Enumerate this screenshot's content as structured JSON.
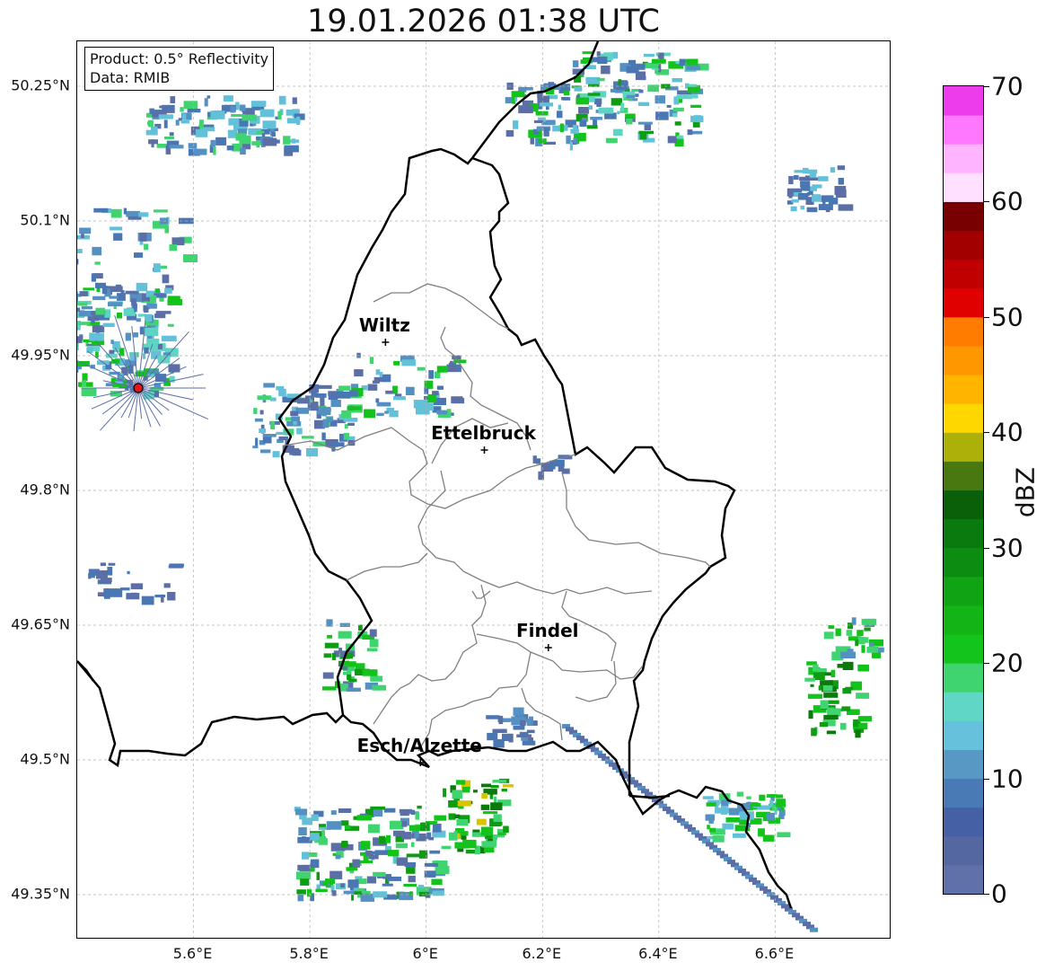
{
  "title": "19.01.2026 01:38 UTC",
  "info": {
    "product": "Product: 0.5° Reflectivity",
    "source": "Data: RMIB"
  },
  "map": {
    "lon_range": [
      5.4,
      6.8
    ],
    "lat_range": [
      49.3,
      50.3
    ],
    "lat_ticks": [
      {
        "value": 50.25,
        "label": "50.25°N"
      },
      {
        "value": 50.1,
        "label": "50.1°N"
      },
      {
        "value": 49.95,
        "label": "49.95°N"
      },
      {
        "value": 49.8,
        "label": "49.8°N"
      },
      {
        "value": 49.65,
        "label": "49.65°N"
      },
      {
        "value": 49.5,
        "label": "49.5°N"
      },
      {
        "value": 49.35,
        "label": "49.35°N"
      }
    ],
    "lon_ticks": [
      {
        "value": 5.6,
        "label": "5.6°E"
      },
      {
        "value": 5.8,
        "label": "5.8°E"
      },
      {
        "value": 6.0,
        "label": "6°E"
      },
      {
        "value": 6.2,
        "label": "6.2°E"
      },
      {
        "value": 6.4,
        "label": "6.4°E"
      },
      {
        "value": 6.6,
        "label": "6.6°E"
      }
    ],
    "radar_site": {
      "lon": 5.505,
      "lat": 49.914
    },
    "cities": [
      {
        "name": "Wiltz",
        "lon": 5.93,
        "lat": 49.965
      },
      {
        "name": "Ettelbruck",
        "lon": 6.1,
        "lat": 49.845
      },
      {
        "name": "Findel",
        "lon": 6.21,
        "lat": 49.625
      },
      {
        "name": "Esch/Alzette",
        "lon": 5.99,
        "lat": 49.497
      }
    ],
    "colors": {
      "country_border": "#000000",
      "canton_border": "#808080",
      "radar_site": "#e8141c",
      "grid": "#b0b0b0"
    }
  },
  "colorbar": {
    "label": "dBZ",
    "min": 0,
    "max": 70,
    "ticks": [
      {
        "value": 0,
        "label": "0"
      },
      {
        "value": 10,
        "label": "10"
      },
      {
        "value": 20,
        "label": "20"
      },
      {
        "value": 30,
        "label": "30"
      },
      {
        "value": 40,
        "label": "40"
      },
      {
        "value": 50,
        "label": "50"
      },
      {
        "value": 60,
        "label": "60"
      },
      {
        "value": 70,
        "label": "70"
      }
    ],
    "colors": [
      "#6070a8",
      "#5567a0",
      "#4560a5",
      "#4a7ab5",
      "#5898c5",
      "#66c2dc",
      "#60d6c6",
      "#3fd470",
      "#12c41c",
      "#12b416",
      "#10a414",
      "#0c8c10",
      "#0a7a0e",
      "#0a6008",
      "#4a7810",
      "#acb008",
      "#ffd700",
      "#ffb400",
      "#ff9800",
      "#ff7c00",
      "#e00000",
      "#c00000",
      "#a00000",
      "#780000",
      "#ffe0ff",
      "#ffb4ff",
      "#ff78ff",
      "#ec3cec"
    ]
  },
  "echo_palette": [
    "#5b6fa6",
    "#4a76b3",
    "#5590c2",
    "#62c0d8",
    "#5fd4c4",
    "#3fd470",
    "#14c21c",
    "#0e9c12",
    "#0a7a0c",
    "#d8c400"
  ]
}
